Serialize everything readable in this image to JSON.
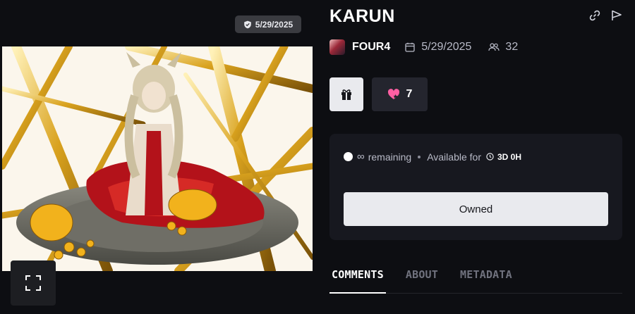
{
  "media": {
    "date_chip": "5/29/2025",
    "icons": {
      "date_chip": "shield-check-icon",
      "fullscreen": "fullscreen-icon"
    }
  },
  "item": {
    "title": "KARUN",
    "creator": "FOUR4",
    "date": "5/29/2025",
    "owners_count": "32",
    "icons": {
      "share": "link-icon",
      "report": "flag-icon",
      "calendar": "calendar-icon",
      "owners": "users-icon"
    }
  },
  "actions": {
    "gift_icon": "gift-icon",
    "like_icon": "heart-icon",
    "like_count": "7"
  },
  "availability": {
    "remaining_symbol": "∞",
    "remaining_label": "remaining",
    "available_label": "Available for",
    "available_value": "3D 0H",
    "primary_button": "Owned"
  },
  "tabs": [
    {
      "label": "COMMENTS",
      "active": true
    },
    {
      "label": "ABOUT",
      "active": false
    },
    {
      "label": "METADATA",
      "active": false
    }
  ],
  "colors": {
    "background": "#0d0e12",
    "panel": "#17181f",
    "light_button": "#e9eaee",
    "muted_text": "#b8bac7",
    "heart": "#ff5fa3"
  }
}
